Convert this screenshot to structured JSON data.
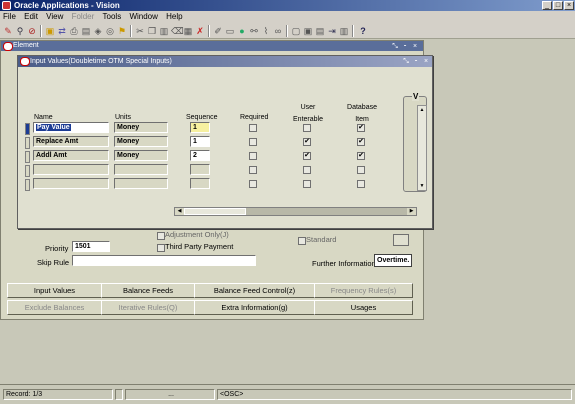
{
  "app": {
    "title": "Oracle Applications - Vision"
  },
  "window_controls": {
    "min": "_",
    "max": "□",
    "close": "×"
  },
  "menu": {
    "items": [
      "File",
      "Edit",
      "View",
      "Folder",
      "Tools",
      "Window",
      "Help"
    ]
  },
  "element_window": {
    "title": "Element"
  },
  "input_values": {
    "title": "Input Values(Doubletime OTM Special Inputs)",
    "headers": {
      "name": "Name",
      "units": "Units",
      "sequence": "Sequence",
      "required": "Required",
      "user_enterable": "User\nEnterable",
      "database_item": "Database\nItem"
    },
    "rows": [
      {
        "name": "Pay Value",
        "units": "Money",
        "sequence": "1",
        "required": false,
        "user_enterable": false,
        "database_item": true
      },
      {
        "name": "Replace Amt",
        "units": "Money",
        "sequence": "1",
        "required": false,
        "user_enterable": true,
        "database_item": true
      },
      {
        "name": "Addl Amt",
        "units": "Money",
        "sequence": "2",
        "required": false,
        "user_enterable": true,
        "database_item": true
      },
      {
        "name": "",
        "units": "",
        "sequence": "",
        "required": false,
        "user_enterable": false,
        "database_item": false
      },
      {
        "name": "",
        "units": "",
        "sequence": "",
        "required": false,
        "user_enterable": false,
        "database_item": false
      }
    ],
    "right_region_label": "V"
  },
  "element_form": {
    "adjustment_only": "Adjustment Only(J)",
    "priority_label": "Priority",
    "priority_value": "1501",
    "third_party_payment": "Third Party Payment",
    "skip_rule_label": "Skip Rule",
    "skip_rule_value": "",
    "standard": "Standard",
    "further_information_label": "Further Information",
    "further_information_value": "Overtime."
  },
  "buttons": [
    {
      "label": "Input Values",
      "enabled": true
    },
    {
      "label": "Balance Feeds",
      "enabled": true
    },
    {
      "label": "Balance Feed Control(z)",
      "enabled": true
    },
    {
      "label": "Frequency Rules(s)",
      "enabled": false
    },
    {
      "label": "Exclude Balances",
      "enabled": false
    },
    {
      "label": "Iterative Rules(Q)",
      "enabled": false
    },
    {
      "label": "Extra Information(g)",
      "enabled": true
    },
    {
      "label": "Usages",
      "enabled": true
    }
  ],
  "status_bar": {
    "record": "Record: 1/3",
    "cell2": "",
    "cell3": "...",
    "osc": "<OSC>"
  }
}
